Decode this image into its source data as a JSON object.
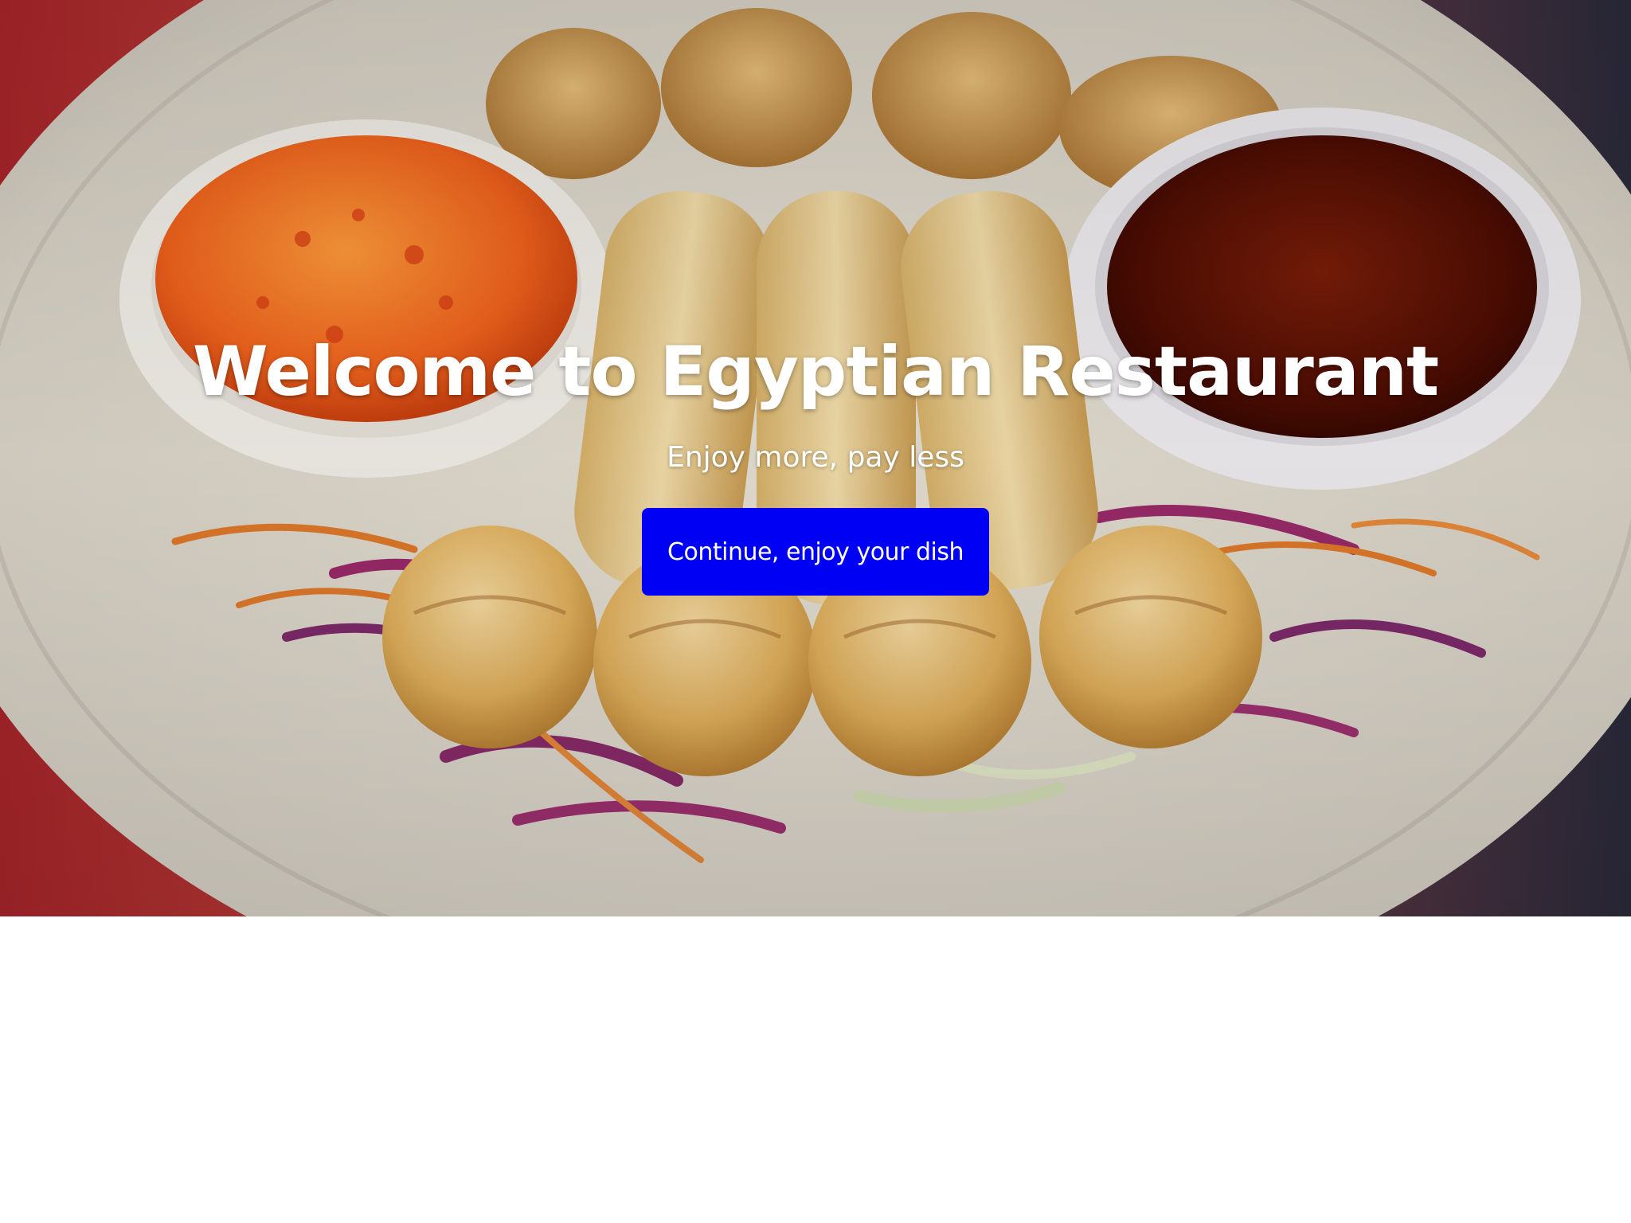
{
  "hero": {
    "image_name": "spring-rolls-and-dumplings-photo",
    "title": "Welcome to Egyptian Restaurant",
    "subtitle": "Enjoy more, pay less",
    "cta_label": "Continue, enjoy your dish"
  },
  "colors": {
    "cta_background": "#0000f5",
    "text": "#ffffff",
    "page_background": "#ffffff"
  }
}
